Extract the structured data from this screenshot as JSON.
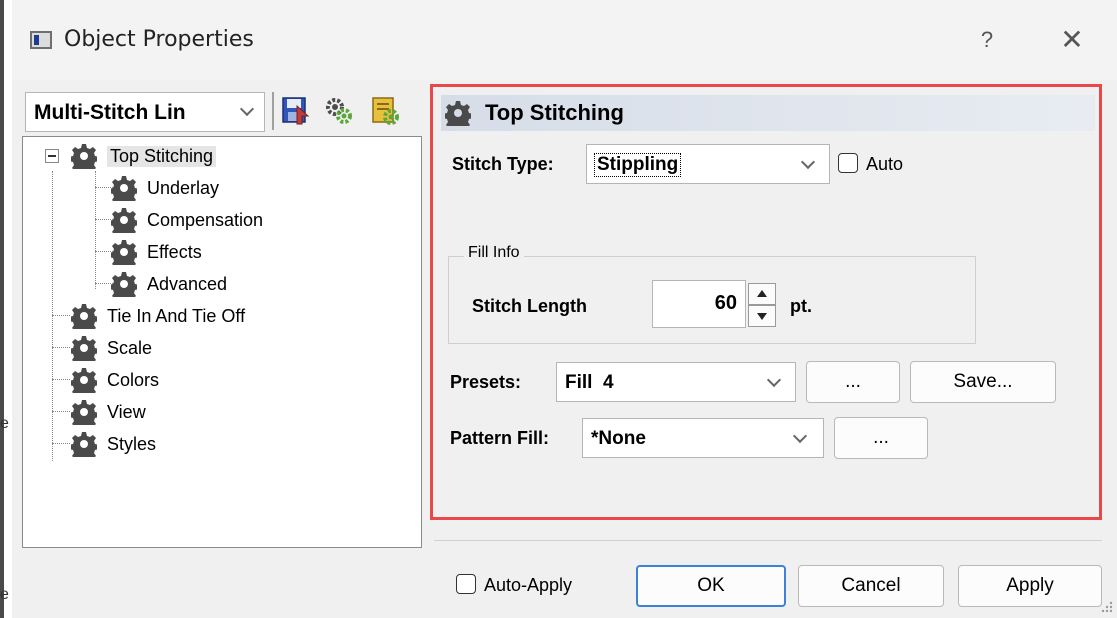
{
  "window": {
    "title": "Object Properties",
    "help_label": "?",
    "close_label": "✕"
  },
  "left_edge": {
    "fragment_1": "e",
    "fragment_2": "e"
  },
  "object_selector": {
    "value": "Multi-Stitch Lin"
  },
  "toolbar_icons": [
    "save-icon",
    "gears-icon",
    "properties-icon"
  ],
  "tree": {
    "items": [
      {
        "label": "Top Stitching",
        "level": 0,
        "selected": true,
        "expanded": true
      },
      {
        "label": "Underlay",
        "level": 1
      },
      {
        "label": "Compensation",
        "level": 1
      },
      {
        "label": "Effects",
        "level": 1
      },
      {
        "label": "Advanced",
        "level": 1
      },
      {
        "label": "Tie In And Tie Off",
        "level": 0
      },
      {
        "label": "Scale",
        "level": 0
      },
      {
        "label": "Colors",
        "level": 0
      },
      {
        "label": "View",
        "level": 0
      },
      {
        "label": "Styles",
        "level": 0
      }
    ]
  },
  "panel": {
    "title": "Top Stitching",
    "stitch_type_label": "Stitch Type:",
    "stitch_type_value": "Stippling",
    "auto_label": "Auto",
    "fill_info_label": "Fill Info",
    "stitch_length_label": "Stitch Length",
    "stitch_length_value": "60",
    "stitch_length_unit": "pt.",
    "presets_label": "Presets:",
    "presets_value": "Fill  4",
    "presets_browse": "...",
    "presets_save": "Save...",
    "pattern_fill_label": "Pattern Fill:",
    "pattern_fill_value": "*None",
    "pattern_browse": "..."
  },
  "footer": {
    "auto_apply_label": "Auto-Apply",
    "ok_label": "OK",
    "cancel_label": "Cancel",
    "apply_label": "Apply"
  },
  "colors": {
    "highlight_border": "#e8484a",
    "default_button_border": "#3d82d6"
  }
}
